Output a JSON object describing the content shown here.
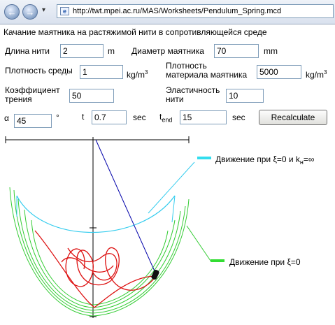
{
  "browser": {
    "address": "http://twt.mpei.ac.ru/MAS/Worksheets/Pendulum_Spring.mcd",
    "back_glyph": "←",
    "forward_glyph": "→",
    "dropdown_glyph": "▾",
    "page_icon_glyph": "e"
  },
  "form": {
    "title": "Качание маятника на растяжимой нити в сопротивляющейся среде",
    "thread_length": {
      "label": "Длина нити",
      "value": "2",
      "unit": "m"
    },
    "diameter": {
      "label": "Диаметр маятника",
      "value": "70",
      "unit": "mm"
    },
    "medium_density": {
      "label": "Плотность среды",
      "value": "1",
      "unit": "kg/m",
      "unit_sup": "3"
    },
    "material_density": {
      "label_line1": "Плотность",
      "label_line2": "материала маятника",
      "value": "5000",
      "unit": "kg/m",
      "unit_sup": "3"
    },
    "friction": {
      "label_line1": "Коэффициент",
      "label_line2": "трения",
      "value": "50"
    },
    "elasticity": {
      "label_line1": "Эластичность",
      "label_line2": "нити",
      "value": "10"
    },
    "alpha": {
      "label": "α",
      "value": "45",
      "unit": "°"
    },
    "t": {
      "label": "t",
      "value": "0.7",
      "unit": "sec"
    },
    "t_end": {
      "label": "t",
      "label_sub": "end",
      "value": "15",
      "unit": "sec"
    },
    "recalculate_label": "Recalculate"
  },
  "plot": {
    "legend_cyan": {
      "text": "Движение при  ξ=0 и k",
      "sub": "н",
      "suffix": "=∞",
      "color": "#33ddee"
    },
    "legend_green": {
      "text": "Движение при  ξ=0",
      "color": "#33dd33"
    },
    "colors": {
      "red": "#dd1111",
      "green": "#33cc33",
      "cyan": "#33ccee",
      "thread": "#0000aa",
      "bob": "#111111"
    }
  }
}
